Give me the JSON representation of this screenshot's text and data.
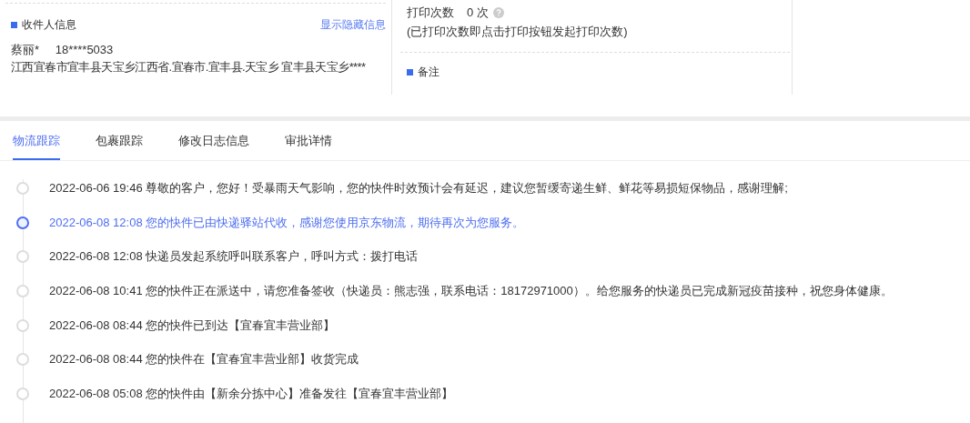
{
  "recipient": {
    "heading": "收件人信息",
    "toggle_link": "显示隐藏信息",
    "name": "蔡丽*",
    "phone": "18****5033",
    "address": "江西宜春市宜丰县天宝乡江西省.宜春市.宜丰县.天宝乡 宜丰县天宝乡****"
  },
  "print": {
    "label": "打印次数",
    "count": "0 次",
    "note": "(已打印次数即点击打印按钮发起打印次数)"
  },
  "remarks": {
    "heading": "备注"
  },
  "tabs": [
    {
      "label": "物流跟踪",
      "selected": true
    },
    {
      "label": "包裹跟踪",
      "selected": false
    },
    {
      "label": "修改日志信息",
      "selected": false
    },
    {
      "label": "审批详情",
      "selected": false
    }
  ],
  "timeline": [
    {
      "time": "2022-06-06 19:46",
      "text": "尊敬的客户，您好！受暴雨天气影响，您的快件时效预计会有延迟，建议您暂缓寄递生鲜、鲜花等易损短保物品，感谢理解;",
      "highlighted": false
    },
    {
      "time": "2022-06-08 12:08",
      "text": "您的快件已由快递驿站代收，感谢您使用京东物流，期待再次为您服务。",
      "highlighted": true
    },
    {
      "time": "2022-06-08 12:08",
      "text": "快递员发起系统呼叫联系客户，呼叫方式：拨打电话",
      "highlighted": false
    },
    {
      "time": "2022-06-08 10:41",
      "text": "您的快件正在派送中，请您准备签收（快递员：熊志强，联系电话：18172971000）。给您服务的快递员已完成新冠疫苗接种，祝您身体健康。",
      "highlighted": false
    },
    {
      "time": "2022-06-08 08:44",
      "text": "您的快件已到达【宜春宜丰营业部】",
      "highlighted": false
    },
    {
      "time": "2022-06-08 08:44",
      "text": "您的快件在【宜春宜丰营业部】收货完成",
      "highlighted": false
    },
    {
      "time": "2022-06-08 05:08",
      "text": "您的快件由【新余分拣中心】准备发往【宜春宜丰营业部】",
      "highlighted": false
    }
  ]
}
